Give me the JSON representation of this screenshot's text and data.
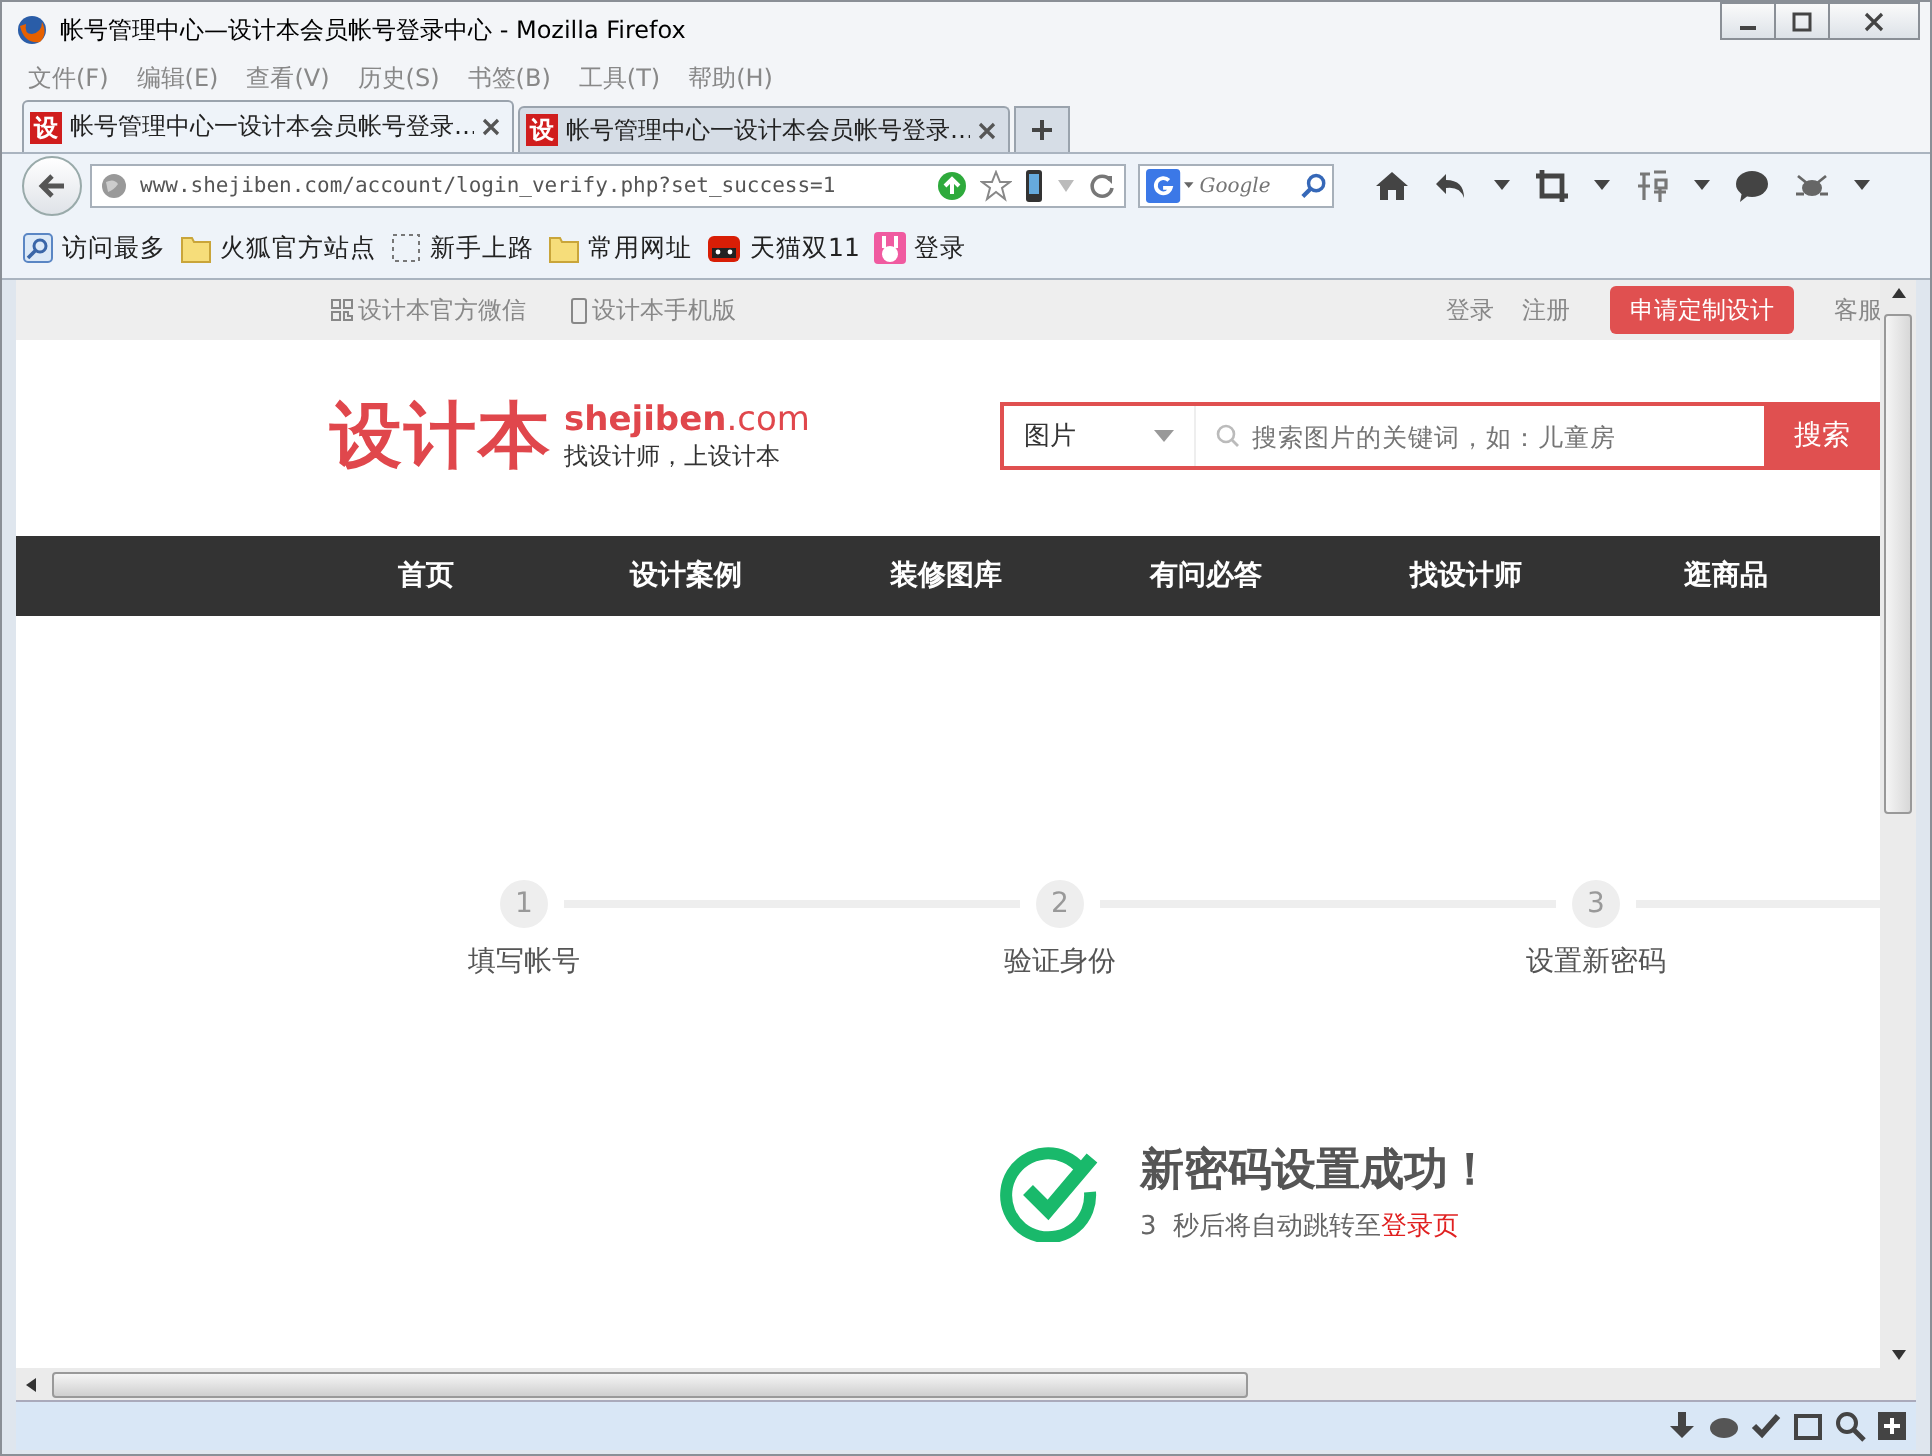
{
  "window": {
    "title": "帐号管理中心—设计本会员帐号登录中心 - Mozilla Firefox"
  },
  "menu": [
    "文件(F)",
    "编辑(E)",
    "查看(V)",
    "历史(S)",
    "书签(B)",
    "工具(T)",
    "帮助(H)"
  ],
  "tabs": [
    {
      "label": "帐号管理中心一设计本会员帐号登录…",
      "favicon": "设",
      "selected": true
    },
    {
      "label": "帐号管理中心一设计本会员帐号登录…",
      "favicon": "设",
      "selected": false
    }
  ],
  "address": {
    "value": "www.shejiben.com/account/login_verify.php?set_success=1"
  },
  "search": {
    "placeholder": "Google"
  },
  "bookmarks": [
    {
      "label": "访问最多",
      "kind": "smart"
    },
    {
      "label": "火狐官方站点",
      "kind": "folder"
    },
    {
      "label": "新手上路",
      "kind": "dashed"
    },
    {
      "label": "常用网址",
      "kind": "folder"
    },
    {
      "label": "天猫双11",
      "kind": "tmall"
    },
    {
      "label": "登录",
      "kind": "bunny"
    }
  ],
  "page": {
    "topbar": {
      "left": [
        {
          "label": "设计本官方微信",
          "kind": "qr"
        },
        {
          "label": "设计本手机版",
          "kind": "phone"
        }
      ],
      "right": [
        "登录",
        "注册"
      ],
      "cta": "申请定制设计",
      "service": "客服"
    },
    "logo": {
      "name": "设计本",
      "domain": "**shejiben**.com",
      "tagline": "找设计师，上设计本"
    },
    "site_search": {
      "category": "图片",
      "placeholder": "搜索图片的关键词，如：儿童房",
      "button": "搜索"
    },
    "nav": [
      "首页",
      "设计案例",
      "装修图库",
      "有问必答",
      "找设计师",
      "逛商品"
    ],
    "steps": [
      {
        "number": "1",
        "label": "填写帐号"
      },
      {
        "number": "2",
        "label": "验证身份"
      },
      {
        "number": "3",
        "label": "设置新密码"
      }
    ],
    "success": {
      "title": "新密码设置成功！",
      "countdown": "3",
      "message": "秒后将自动跳转至",
      "link": "登录页"
    }
  }
}
